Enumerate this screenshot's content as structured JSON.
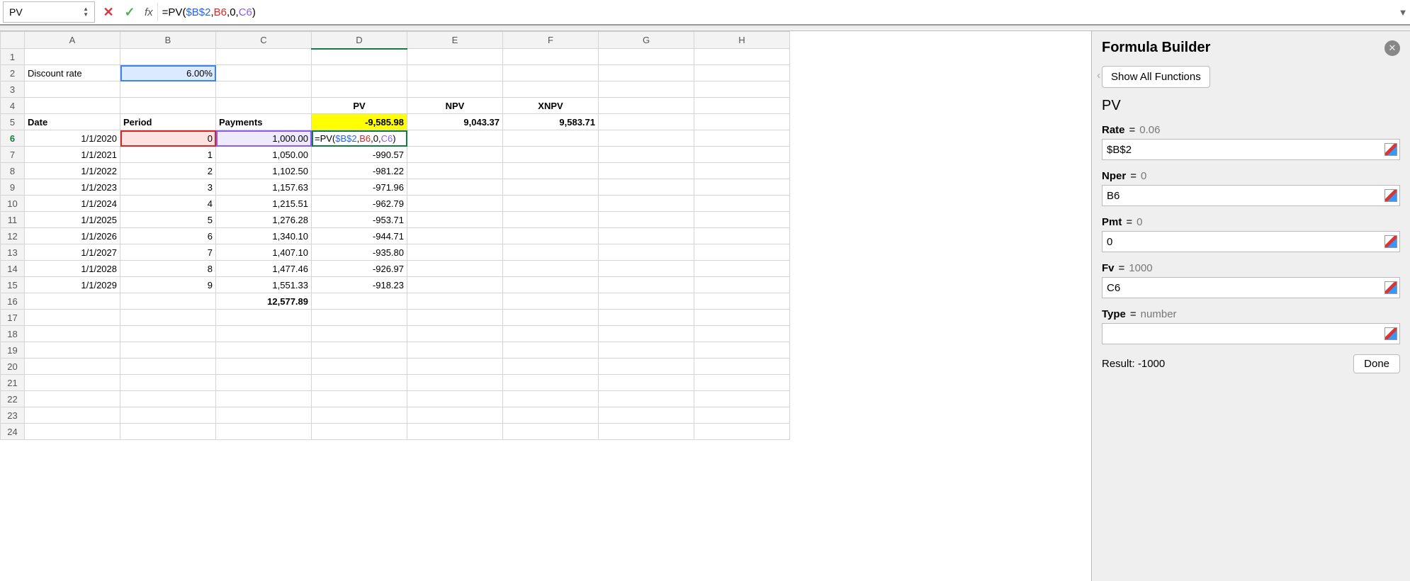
{
  "formula_bar": {
    "name_box": "PV",
    "fx_label": "fx",
    "formula_prefix": "=PV(",
    "formula_arg1": "$B$2",
    "formula_arg2": "B6",
    "formula_arg3": "0",
    "formula_arg4": "C6",
    "formula_suffix": ")"
  },
  "columns": [
    "A",
    "B",
    "C",
    "D",
    "E",
    "F",
    "G",
    "H"
  ],
  "row_count": 24,
  "cells": {
    "A2": "Discount rate",
    "B2": "6.00%",
    "D4": "PV",
    "E4": "NPV",
    "F4": "XNPV",
    "A5": "Date",
    "B5": "Period",
    "C5": "Payments",
    "D5": "-9,585.98",
    "E5": "9,043.37",
    "F5": "9,583.71",
    "A6": "1/1/2020",
    "B6": "0",
    "C6": "1,000.00",
    "D6": "=PV($B$2,B6,0,C6)",
    "A7": "1/1/2021",
    "B7": "1",
    "C7": "1,050.00",
    "D7": "-990.57",
    "A8": "1/1/2022",
    "B8": "2",
    "C8": "1,102.50",
    "D8": "-981.22",
    "A9": "1/1/2023",
    "B9": "3",
    "C9": "1,157.63",
    "D9": "-971.96",
    "A10": "1/1/2024",
    "B10": "4",
    "C10": "1,215.51",
    "D10": "-962.79",
    "A11": "1/1/2025",
    "B11": "5",
    "C11": "1,276.28",
    "D11": "-953.71",
    "A12": "1/1/2026",
    "B12": "6",
    "C12": "1,340.10",
    "D12": "-944.71",
    "A13": "1/1/2027",
    "B13": "7",
    "C13": "1,407.10",
    "D13": "-935.80",
    "A14": "1/1/2028",
    "B14": "8",
    "C14": "1,477.46",
    "D14": "-926.97",
    "A15": "1/1/2029",
    "B15": "9",
    "C15": "1,551.33",
    "D15": "-918.23",
    "C16": "12,577.89"
  },
  "sidebar": {
    "title": "Formula Builder",
    "show_all": "Show All Functions",
    "fn_name": "PV",
    "args": [
      {
        "label": "Rate",
        "preview": "0.06",
        "value": "$B$2"
      },
      {
        "label": "Nper",
        "preview": "0",
        "value": "B6"
      },
      {
        "label": "Pmt",
        "preview": "0",
        "value": "0"
      },
      {
        "label": "Fv",
        "preview": "1000",
        "value": "C6"
      },
      {
        "label": "Type",
        "preview": "number",
        "value": ""
      }
    ],
    "result_label": "Result: -1000",
    "done": "Done"
  }
}
